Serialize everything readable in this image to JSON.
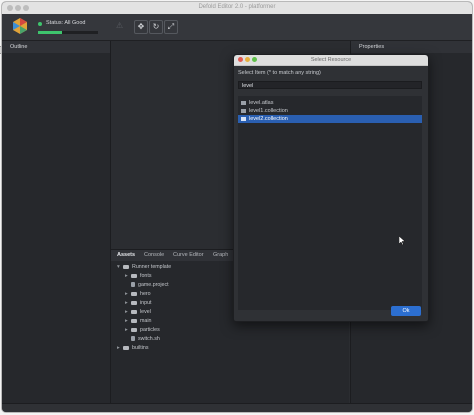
{
  "window": {
    "title": "Defold Editor 2.0 - platformer"
  },
  "toolbar": {
    "status_text": "Status: All Good",
    "progress_fraction": 0.4
  },
  "outline": {
    "title": "Outline"
  },
  "properties": {
    "title": "Properties"
  },
  "assets": {
    "tabs": [
      "Assets",
      "Console",
      "Curve Editor",
      "Graph"
    ],
    "tree": [
      {
        "label": "Runner template",
        "type": "folder",
        "depth": 0,
        "expanded": true
      },
      {
        "label": "fonts",
        "type": "folder",
        "depth": 1
      },
      {
        "label": "game.project",
        "type": "file",
        "depth": 1
      },
      {
        "label": "hero",
        "type": "folder",
        "depth": 1
      },
      {
        "label": "input",
        "type": "folder",
        "depth": 1
      },
      {
        "label": "level",
        "type": "folder",
        "depth": 1
      },
      {
        "label": "main",
        "type": "folder",
        "depth": 1
      },
      {
        "label": "particles",
        "type": "folder",
        "depth": 1
      },
      {
        "label": "switch.sh",
        "type": "file",
        "depth": 1
      },
      {
        "label": "builtins",
        "type": "folder",
        "depth": 0
      }
    ]
  },
  "dialog": {
    "title": "Select Resource",
    "label": "Select Item (* to match any string)",
    "filter_value": "level",
    "results": [
      {
        "label": "level.atlas",
        "selected": false
      },
      {
        "label": "level1.collection",
        "selected": false
      },
      {
        "label": "level2.collection",
        "selected": true
      }
    ],
    "ok_label": "Ok"
  },
  "colors": {
    "accent": "#2c6fd1",
    "status_ok": "#3ec46d",
    "selection": "#2a5fb1"
  },
  "icons": [
    "defold-logo-icon",
    "warning-icon",
    "move-tool-icon",
    "rotate-tool-icon",
    "scale-tool-icon",
    "folder-icon",
    "file-icon",
    "atlas-icon",
    "collection-icon",
    "mouse-cursor-icon"
  ]
}
